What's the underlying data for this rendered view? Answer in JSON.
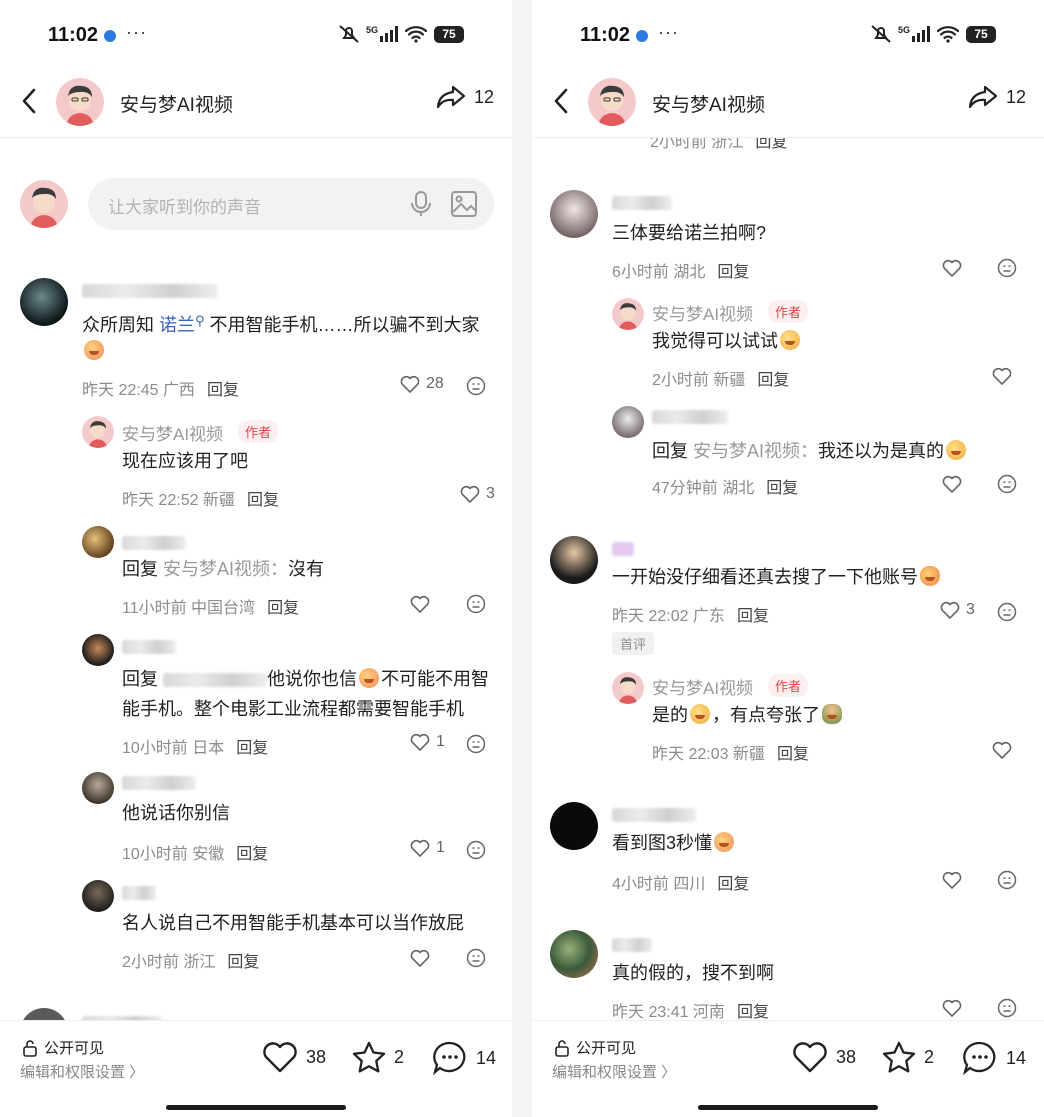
{
  "status": {
    "time": "11:02",
    "more": "···",
    "network": "5G",
    "battery": "75"
  },
  "nav": {
    "title": "安与梦AI视频",
    "share_count": "12"
  },
  "input": {
    "placeholder": "让大家听到你的声音"
  },
  "left_comments": {
    "c1": {
      "text_a": "众所周知 ",
      "text_hl": "诺兰",
      "text_b": " 不用智能手机……所以骗不到大家",
      "time": "昨天 22:45 广西",
      "reply": "回复",
      "likes": "28"
    },
    "c1r1": {
      "name": "安与梦AI视频",
      "tag": "作者",
      "text": "现在应该用了吧",
      "time": "昨天 22:52 新疆",
      "reply": "回复",
      "likes": "3"
    },
    "c1r2": {
      "text_a": "回复 ",
      "text_to": "安与梦AI视频：",
      "text_b": "沒有",
      "time": "11小时前 中国台湾",
      "reply": "回复"
    },
    "c1r3": {
      "text_a": "回复 ",
      "text_b": "他说你也信",
      "text_c": "不可能不用智",
      "text_d": "能手机。整个电影工业流程都需要智能手机",
      "time": "10小时前 日本",
      "reply": "回复",
      "likes": "1"
    },
    "c1r4": {
      "text": "他说话你别信",
      "time": "10小时前 安徽",
      "reply": "回复",
      "likes": "1"
    },
    "c1r5": {
      "text": "名人说自己不用智能手机基本可以当作放屁",
      "time": "2小时前 浙江",
      "reply": "回复"
    }
  },
  "right_comments": {
    "top": {
      "time": "2小时前 浙江",
      "reply": "回复"
    },
    "c2": {
      "text": "三体要给诺兰拍啊?",
      "time": "6小时前 湖北",
      "reply": "回复"
    },
    "c2r1": {
      "name": "安与梦AI视频",
      "tag": "作者",
      "text": "我觉得可以试试",
      "time": "2小时前 新疆",
      "reply": "回复"
    },
    "c2r2": {
      "text_a": "回复 ",
      "text_to": "安与梦AI视频：",
      "text_b": "我还以为是真的",
      "time": "47分钟前 湖北",
      "reply": "回复"
    },
    "c3": {
      "text": "一开始没仔细看还真去搜了一下他账号",
      "time": "昨天 22:02 广东",
      "reply": "回复",
      "likes": "3",
      "badge": "首评"
    },
    "c3r1": {
      "name": "安与梦AI视频",
      "tag": "作者",
      "text_a": "是的",
      "text_b": "，有点夸张了",
      "time": "昨天 22:03 新疆",
      "reply": "回复"
    },
    "c4": {
      "text": "看到图3秒懂",
      "time": "4小时前 四川",
      "reply": "回复"
    },
    "c5": {
      "text": "真的假的，搜不到啊",
      "time": "昨天 23:41 河南",
      "reply": "回复"
    }
  },
  "bottom": {
    "visibility": "公开可见",
    "settings": "编辑和权限设置 〉",
    "likes": "38",
    "favorites": "2",
    "comments": "14"
  },
  "colors": {
    "accent_link": "#3a64b8",
    "author_tag": "#e2444d",
    "meta": "#8c8c8c"
  }
}
